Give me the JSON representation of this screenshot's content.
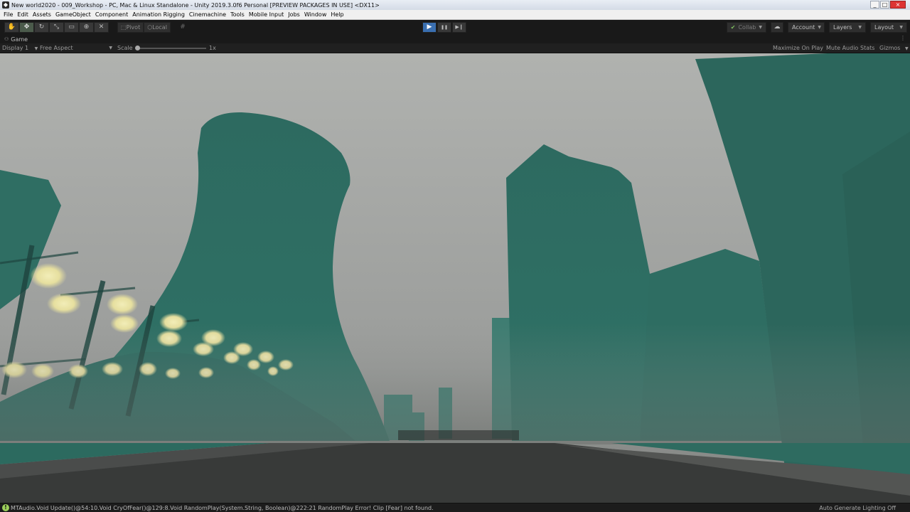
{
  "window": {
    "title": "New world2020 - 009_Workshop - PC, Mac & Linux Standalone - Unity 2019.3.0f6 Personal [PREVIEW PACKAGES IN USE] <DX11>",
    "controls": [
      "_",
      "□",
      "×"
    ]
  },
  "menubar": {
    "items": [
      "File",
      "Edit",
      "Assets",
      "GameObject",
      "Component",
      "Animation Rigging",
      "Cinemachine",
      "Tools",
      "Mobile Input",
      "Jobs",
      "Window",
      "Help"
    ]
  },
  "toolbar": {
    "tools": [
      {
        "icon": "hand-icon",
        "glyph": "✋"
      },
      {
        "icon": "move-icon",
        "glyph": "✥"
      },
      {
        "icon": "rotate-icon",
        "glyph": "↻"
      },
      {
        "icon": "scale-icon",
        "glyph": "⤡"
      },
      {
        "icon": "rect-icon",
        "glyph": "▭"
      },
      {
        "icon": "transform-icon",
        "glyph": "⊕"
      },
      {
        "icon": "custom-tool-icon",
        "glyph": "✕"
      }
    ],
    "active_tool": 1,
    "pivot_label": "Pivot",
    "local_label": "Local",
    "play": {
      "play_glyph": "▶",
      "pause_glyph": "❚❚",
      "step_glyph": "▶❙"
    },
    "collab_label": "Collab",
    "account_label": "Account",
    "layers_label": "Layers",
    "layout_label": "Layout"
  },
  "panel": {
    "tab_label": "Game",
    "display_label": "Display 1",
    "aspect_label": "Free Aspect",
    "scale_label": "Scale",
    "scale_value": "1x",
    "maximize_label": "Maximize On Play",
    "mute_label": "Mute Audio",
    "stats_label": "Stats",
    "gizmos_label": "Gizmos"
  },
  "status": {
    "message_prefix": "MTAudio.Void Update()@54:10.Void CryOfFear()@129:8.Void RandomPlay(System.String, Boolean)@222:21",
    "message_suffix": " RandomPlay Error! Clip [Fear] not found.",
    "right_label": "Auto Generate Lighting Off"
  },
  "colors": {
    "sky": "#a9aba9",
    "building": "#2f6e63",
    "road": "#3a3a3a",
    "lamp": "#efe9b0",
    "play_active": "#3a6fb0"
  }
}
